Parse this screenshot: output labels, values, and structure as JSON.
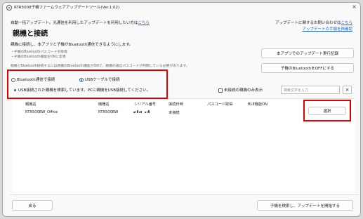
{
  "window": {
    "title": "RTR5008子機ファームウェアアップデートツール(Ver.1.02)",
    "close_glyph": "×"
  },
  "header": {
    "auto_update_text": "自動一括アップデート。光通信を利用したアップデートを利用したい方は",
    "auto_update_link": "こちら",
    "inquiry_text": "アップデートに関するお問い合わせは",
    "inquiry_link": "こちら",
    "procedure_link": "アップデートの手順を再確認",
    "page_title": "親機と接続",
    "description": "親機に接続し、本アプリと子機がBluetooth通信できるようにします。",
    "notes": [
      "・子機のBluetoothパスコードを取得",
      "・子機のBluetooth機能をONに変更"
    ],
    "notice": "親機とBluetooth接続するには親機のBluetooth機能がONで、親機の通信パスコードが判明している必要があります。"
  },
  "actions": {
    "update_history_label": "本アプリでのアップデート実行記録",
    "bluetooth_off_label": "子機のBluetoothをOFFにする"
  },
  "connection": {
    "bluetooth_option": "Bluetooth通信で接続",
    "usb_option": "USBケーブルで接続",
    "selected": "usb",
    "status_message": "USB接続された親機を検索しています。PCに親機をUSB接続してください。"
  },
  "filter": {
    "unconnected_only_label": "未接続の親機のみ表示",
    "unconnected_only_checked": false,
    "search_placeholder": "検索文字を入力",
    "clear_glyph": "×"
  },
  "table": {
    "columns": [
      "親機名",
      "機種名",
      "シリアル番号",
      "接続日時",
      "パスコード取得",
      "BLE機能ON"
    ],
    "rows": [
      {
        "name": "RTR500BW_Office",
        "model": "RTR500BW",
        "serial": "",
        "connected_at": "未接続",
        "passcode": "",
        "ble_on": "",
        "select_label": "選択"
      }
    ]
  },
  "footer": {
    "back_label": "戻る",
    "start_label": "子機を検索し、アップデートを開始する"
  },
  "colors": {
    "accent": "#1a5fc7",
    "highlight": "#e00000",
    "background": "#f9f9f9"
  }
}
